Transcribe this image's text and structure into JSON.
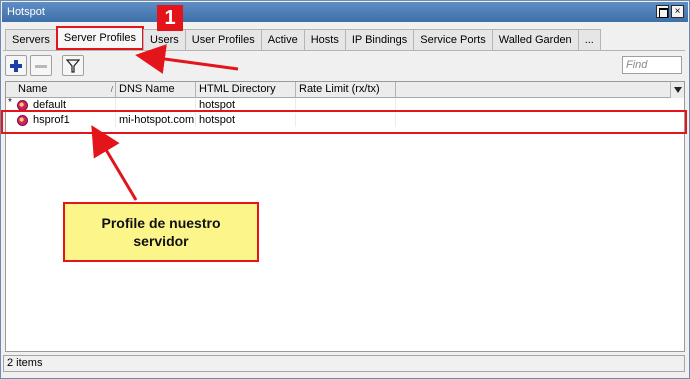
{
  "window": {
    "title": "Hotspot",
    "max_btn": "",
    "close_btn": "×"
  },
  "tabs": [
    {
      "label": "Servers"
    },
    {
      "label": "Server Profiles"
    },
    {
      "label": "Users"
    },
    {
      "label": "User Profiles"
    },
    {
      "label": "Active"
    },
    {
      "label": "Hosts"
    },
    {
      "label": "IP Bindings"
    },
    {
      "label": "Service Ports"
    },
    {
      "label": "Walled Garden"
    },
    {
      "label": "..."
    }
  ],
  "toolbar": {
    "find_placeholder": "Find"
  },
  "table": {
    "columns": [
      "Name",
      "DNS Name",
      "HTML Directory",
      "Rate Limit (rx/tx)"
    ],
    "sort_marker": "/",
    "rows": [
      {
        "flag": "*",
        "name": "default",
        "dns": "",
        "html_dir": "hotspot",
        "rate": ""
      },
      {
        "flag": "",
        "name": "hsprof1",
        "dns": "mi-hotspot.com",
        "html_dir": "hotspot",
        "rate": ""
      }
    ]
  },
  "annotation": {
    "badge": "1",
    "callout_line1": "Profile de nuestro",
    "callout_line2": "servidor"
  },
  "status": {
    "items": "2 items"
  },
  "colors": {
    "highlight": "#e3141a",
    "callout_bg": "#fbf58a",
    "titlebar": "#4a7cb8"
  }
}
